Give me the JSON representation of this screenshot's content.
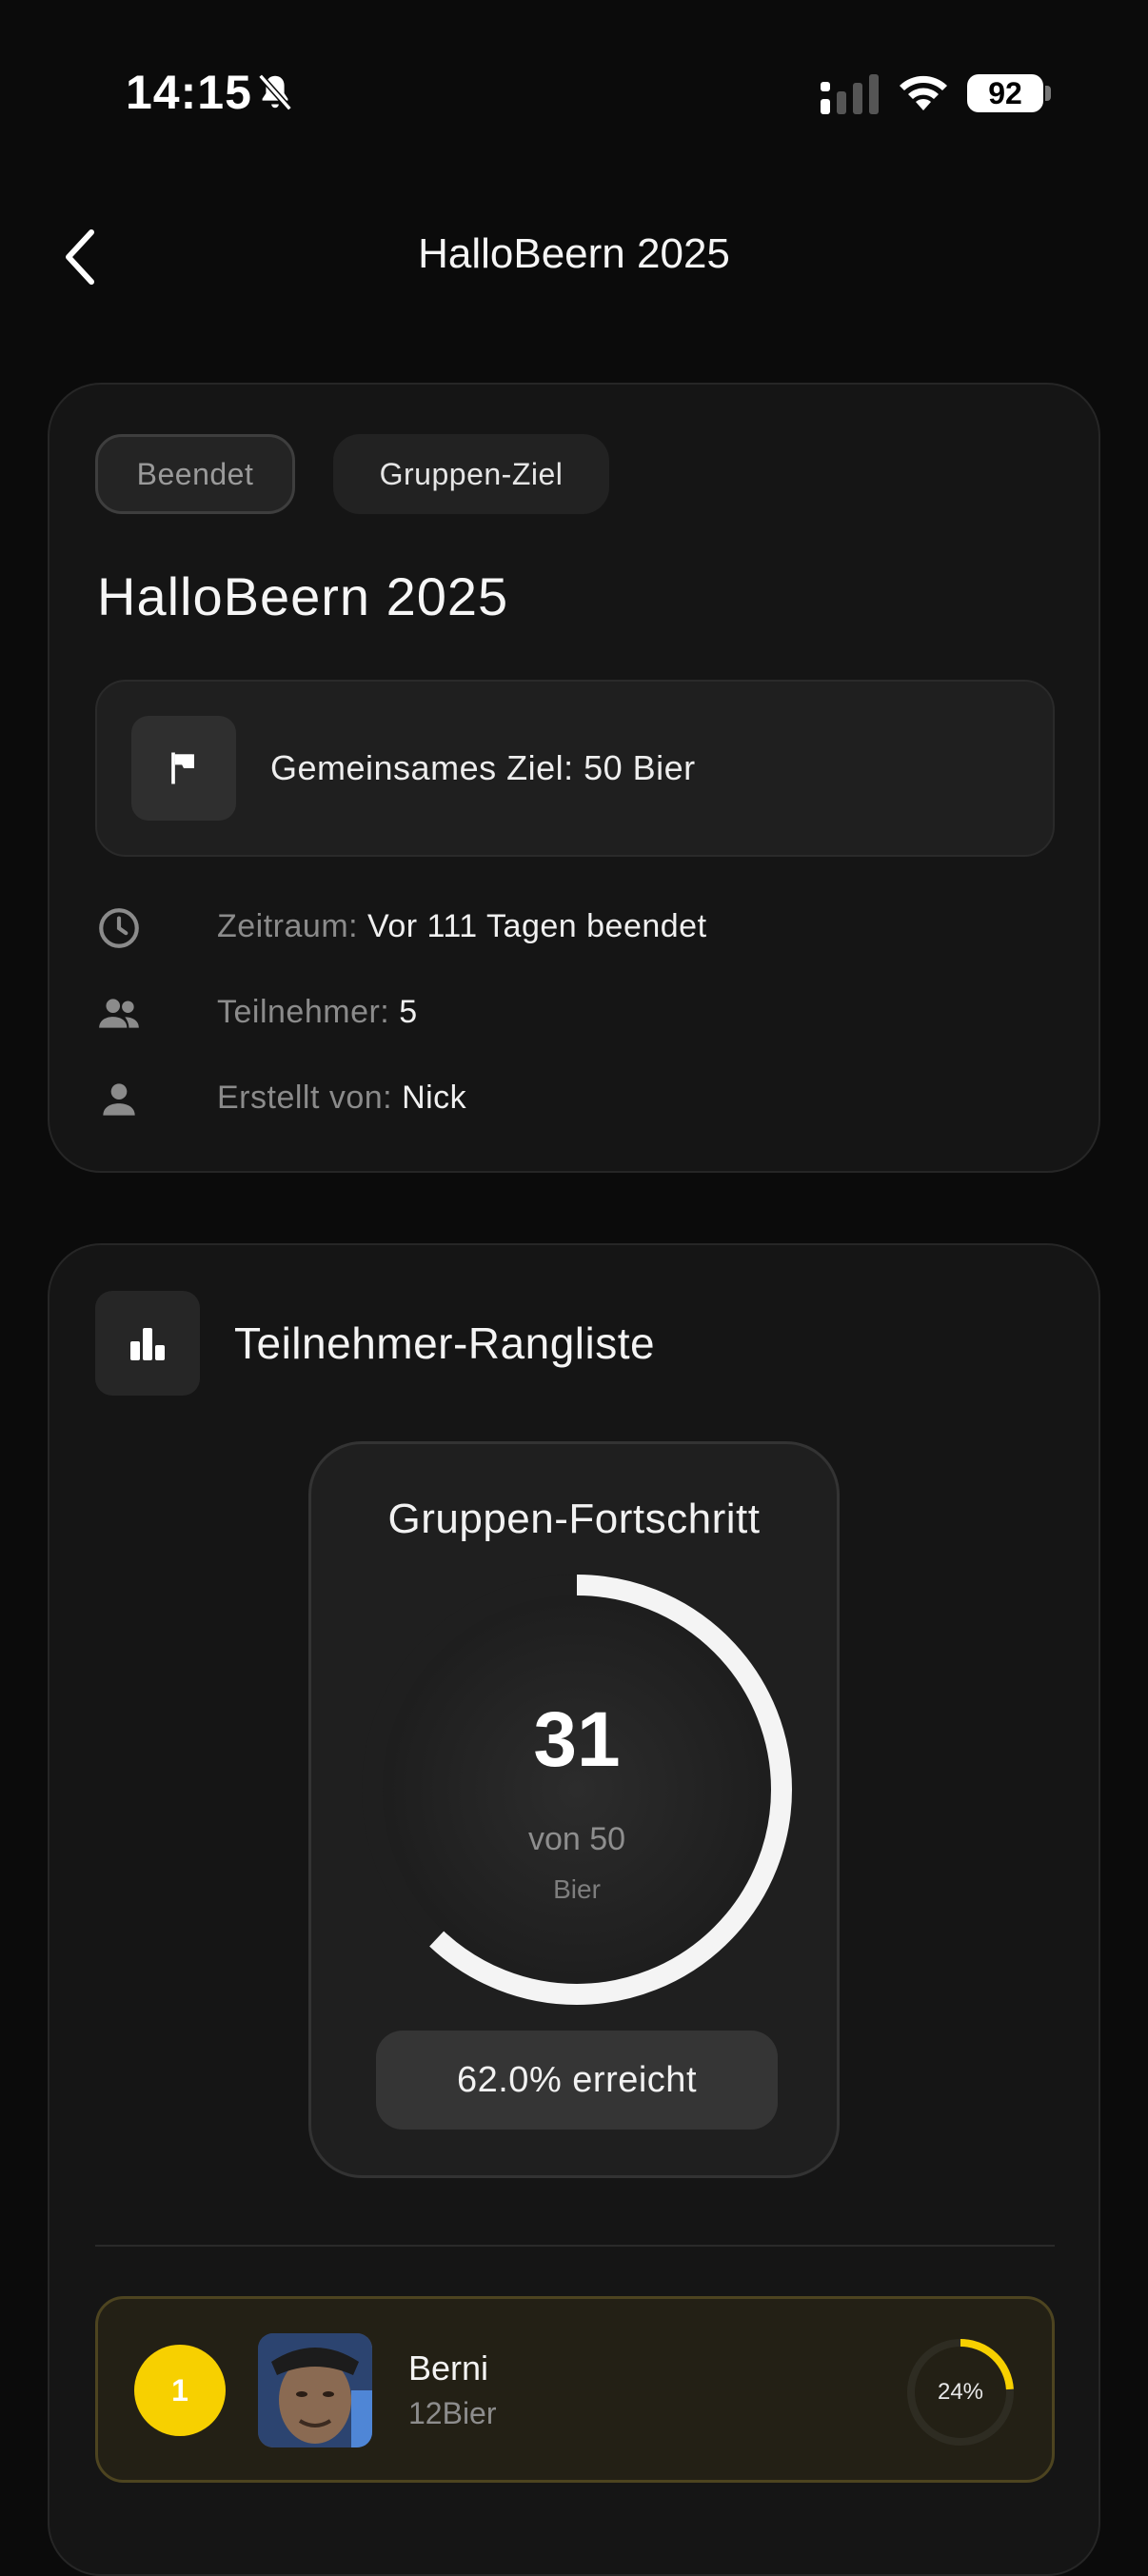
{
  "status_bar": {
    "time": "14:15",
    "battery": "92",
    "icons": [
      "bell-slash-icon",
      "signal-icon",
      "wifi-icon",
      "battery-icon"
    ]
  },
  "nav": {
    "title": "HalloBeern 2025",
    "back_icon": "chevron-left-icon"
  },
  "event": {
    "badges": [
      "Beendet",
      "Gruppen-Ziel"
    ],
    "title": "HalloBeern 2025",
    "goal_text": "Gemeinsames Ziel: 50 Bier",
    "goal_icon": "flag-icon",
    "meta": [
      {
        "icon": "clock-icon",
        "label": "Zeitraum:",
        "value": "Vor 111 Tagen beendet"
      },
      {
        "icon": "people-icon",
        "label": "Teilnehmer:",
        "value": "5"
      },
      {
        "icon": "person-icon",
        "label": "Erstellt von:",
        "value": "Nick"
      }
    ]
  },
  "ranking": {
    "title": "Teilnehmer-Rangliste",
    "icon": "bar-chart-icon",
    "progress": {
      "title": "Gruppen-Fortschritt",
      "current": "31",
      "of_text": "von 50",
      "unit": "Bier",
      "fraction": 0.62,
      "achieved_text": "62.0% erreicht"
    },
    "entries": [
      {
        "place": "1",
        "name": "Berni",
        "score": "12Bier",
        "percent_text": "24%",
        "fraction": 0.24
      }
    ]
  },
  "colors": {
    "background": "#0b0b0b",
    "card": "#151515",
    "accent_gold": "#f7d000",
    "ring": "#f4f4f4"
  }
}
